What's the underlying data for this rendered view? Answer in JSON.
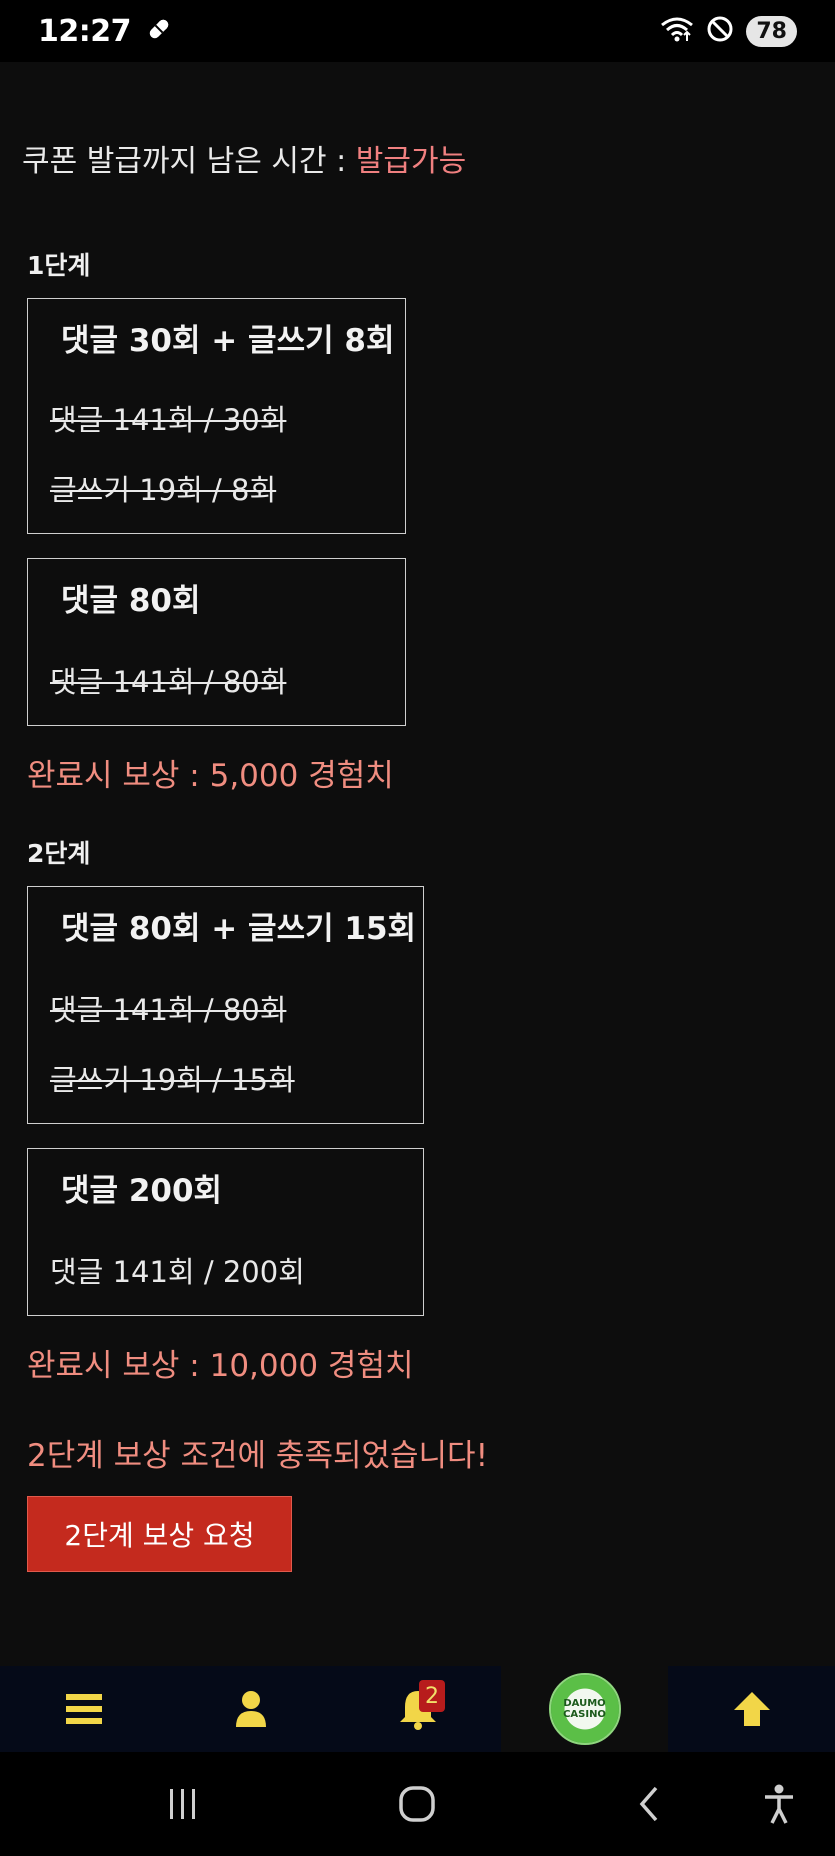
{
  "status_bar": {
    "time": "12:27",
    "battery": "78",
    "icons": [
      "capsule-icon",
      "wifi-icon",
      "do-not-disturb-icon"
    ]
  },
  "coupon": {
    "label": "쿠폰 발급까지 남은 시간 : ",
    "value": "발급가능",
    "value_color": "#f08080"
  },
  "stages": [
    {
      "title": "1단계",
      "quests": [
        {
          "title": "댓글 30회 + 글쓰기 8회",
          "progress": [
            {
              "text": "댓글 141회 / 30회",
              "completed": true
            },
            {
              "text": "글쓰기 19회 / 8회",
              "completed": true
            }
          ]
        },
        {
          "title": "댓글 80회",
          "progress": [
            {
              "text": "댓글 141회 / 80회",
              "completed": true
            }
          ]
        }
      ],
      "reward": "완료시 보상 : 5,000 경험치"
    },
    {
      "title": "2단계",
      "quests": [
        {
          "title": "댓글 80회 + 글쓰기 15회",
          "progress": [
            {
              "text": "댓글 141회 / 80회",
              "completed": true
            },
            {
              "text": "글쓰기 19회 / 15회",
              "completed": true
            }
          ]
        },
        {
          "title": "댓글 200회",
          "progress": [
            {
              "text": "댓글 141회 / 200회",
              "completed": false
            }
          ]
        }
      ],
      "reward": "완료시 보상 : 10,000 경험치"
    }
  ],
  "notice": "2단계 보상 조건에 충족되었습니다!",
  "claim_button": "2단계 보상 요청",
  "bottom_nav": {
    "notification_count": "2",
    "casino_logo_text": "DAUMO CASINO",
    "accent_color": "#f2d648"
  },
  "colors": {
    "background": "#0d0d0d",
    "reward_text": "#f08d80",
    "button": "#c42a1e"
  }
}
